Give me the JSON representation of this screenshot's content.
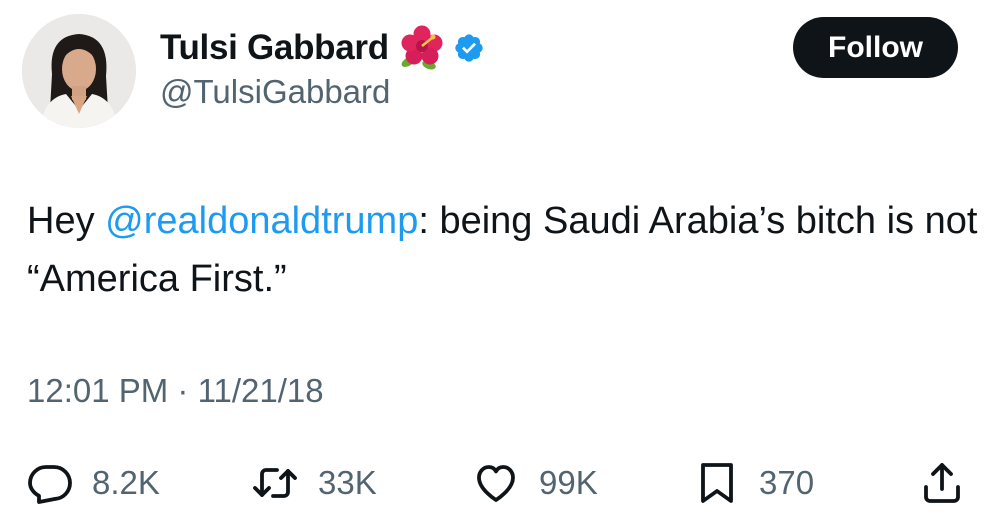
{
  "author": {
    "name": "Tulsi Gabbard",
    "handle": "@TulsiGabbard",
    "name_emoji_icon": "hibiscus-icon",
    "verified_icon": "verified-badge-icon"
  },
  "follow_button": {
    "label": "Follow"
  },
  "tweet": {
    "text_before": "Hey ",
    "mention": "@realdonaldtrump",
    "text_after": ": being Saudi Arabia’s bitch is not “America First.”",
    "time": "12:01 PM",
    "separator": "·",
    "date": "11/21/18"
  },
  "actions": {
    "replies": {
      "icon": "reply-icon",
      "count": "8.2K"
    },
    "reposts": {
      "icon": "repost-icon",
      "count": "33K"
    },
    "likes": {
      "icon": "like-icon",
      "count": "99K"
    },
    "bookmarks": {
      "icon": "bookmark-icon",
      "count": "370"
    },
    "share": {
      "icon": "share-icon"
    }
  },
  "colors": {
    "text": "#0f1419",
    "secondary": "#536471",
    "accent": "#1d9bf0",
    "button": "#0f1419",
    "flower": "#e0245e"
  }
}
